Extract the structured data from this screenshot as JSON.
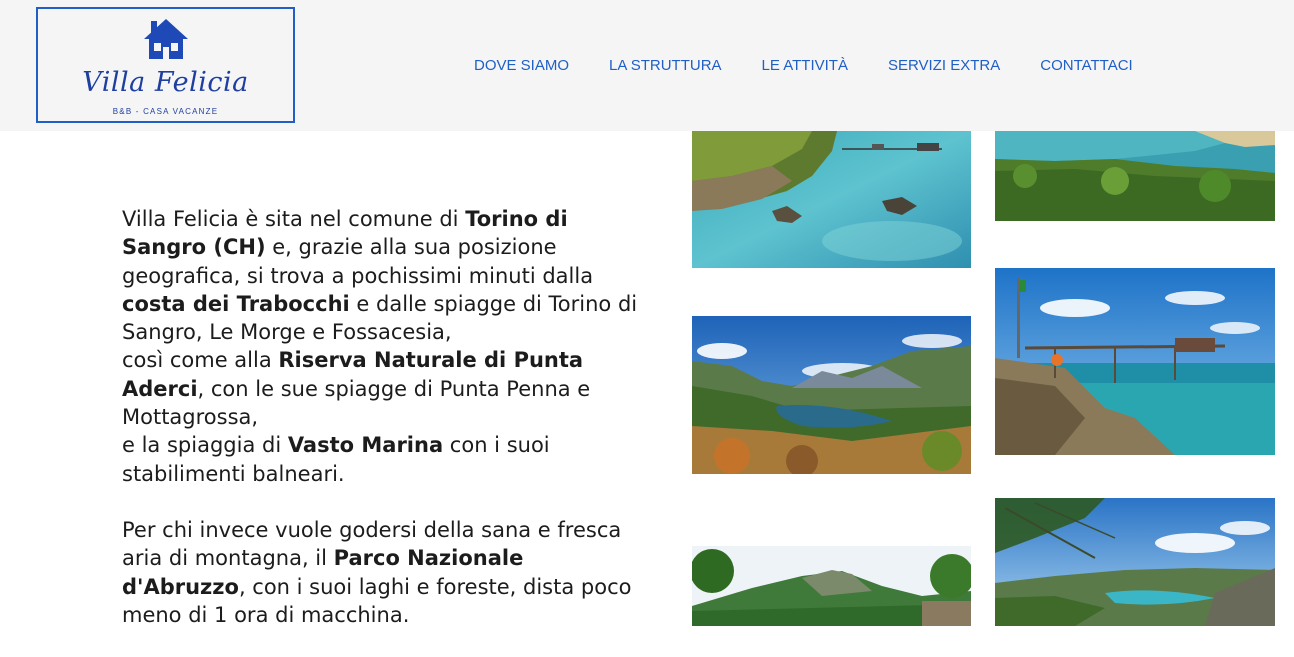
{
  "brand": {
    "name": "Villa Felicia",
    "tagline": "B&B - CASA VACANZE",
    "color": "#1f5fc6"
  },
  "nav": {
    "items": [
      "DOVE SIAMO",
      "LA STRUTTURA",
      "LE ATTIVITÀ",
      "SERVIZI EXTRA",
      "CONTATTACI"
    ]
  },
  "intro": {
    "p1": {
      "t1": "Villa Felicia è sita nel comune di ",
      "b1": "Torino di Sangro (CH)",
      "t2": " e, grazie alla sua posizione geografica, si trova a pochissimi minuti dalla ",
      "b2": "costa dei Trabocchi",
      "t3": " e dalle spiagge di Torino di Sangro, Le Morge e Fossacesia,",
      "t4": "così come alla ",
      "b3": "Riserva Naturale di Punta Aderci",
      "t5": ", con le sue spiagge di Punta Penna e Mottagrossa,",
      "t6": "e la spiaggia di ",
      "b4": "Vasto Marina",
      "t7": " con i suoi stabilimenti balneari."
    },
    "p2": {
      "t1": "Per chi invece vuole godersi della sana e fresca aria di montagna, il ",
      "b1": "Parco Nazionale d'Abruzzo",
      "t2": ", con i suoi laghi e foreste, dista poco meno di 1 ora di macchina."
    }
  },
  "gallery": {
    "photos": [
      {
        "name": "coast-trabocco-aerial"
      },
      {
        "name": "sea-beach-panorama"
      },
      {
        "name": "mountain-lake-valley"
      },
      {
        "name": "trabocco-pier"
      },
      {
        "name": "mountain-forest"
      },
      {
        "name": "lake-from-pines"
      }
    ]
  }
}
